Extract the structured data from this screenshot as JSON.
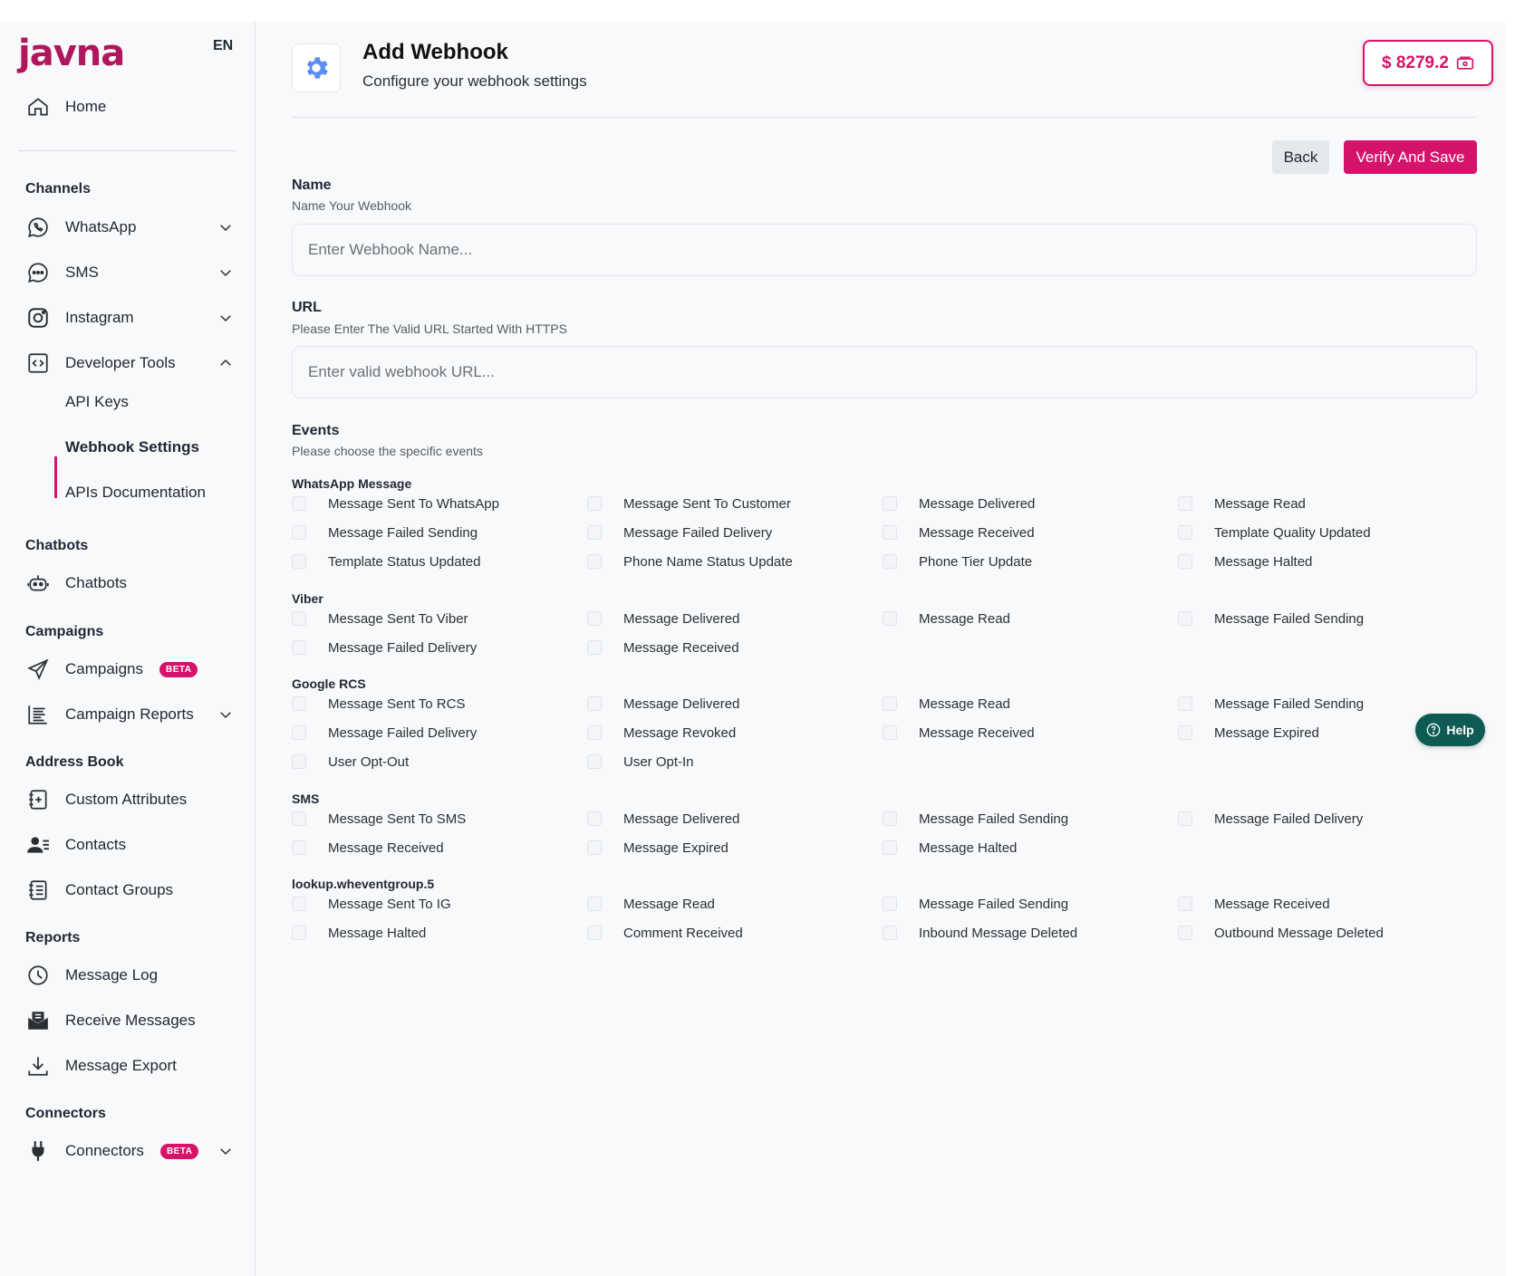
{
  "brand": {
    "logo_text": "javna",
    "language": "EN",
    "accent_color": "#d6136a",
    "help_color": "#0d5b52"
  },
  "sidebar": {
    "home": "Home",
    "sections": {
      "channels": "Channels",
      "chatbots": "Chatbots",
      "campaigns": "Campaigns",
      "address_book": "Address Book",
      "reports": "Reports",
      "connectors": "Connectors"
    },
    "channels": {
      "whatsapp": "WhatsApp",
      "sms": "SMS",
      "instagram": "Instagram",
      "developer_tools": "Developer Tools",
      "api_keys": "API Keys",
      "webhook_settings": "Webhook Settings",
      "apis_documentation": "APIs Documentation"
    },
    "chatbots_item": "Chatbots",
    "campaigns_item": "Campaigns",
    "campaigns_badge": "BETA",
    "campaign_reports": "Campaign Reports",
    "custom_attributes": "Custom Attributes",
    "contacts": "Contacts",
    "contact_groups": "Contact Groups",
    "message_log": "Message Log",
    "receive_messages": "Receive Messages",
    "message_export": "Message Export",
    "connectors_item": "Connectors",
    "connectors_badge": "BETA"
  },
  "header": {
    "title": "Add Webhook",
    "subtitle": "Configure your webhook settings",
    "balance": "$ 8279.2"
  },
  "actions": {
    "back": "Back",
    "save": "Verify And Save"
  },
  "form": {
    "name_label": "Name",
    "name_hint": "Name Your Webhook",
    "name_placeholder": "Enter Webhook Name...",
    "url_label": "URL",
    "url_hint": "Please Enter The Valid URL Started With HTTPS",
    "url_placeholder": "Enter valid webhook URL...",
    "events_label": "Events",
    "events_hint": "Please choose the specific events"
  },
  "event_groups": [
    {
      "title": "WhatsApp Message",
      "events": [
        "Message Sent To WhatsApp",
        "Message Sent To Customer",
        "Message Delivered",
        "Message Read",
        "Message Failed Sending",
        "Message Failed Delivery",
        "Message Received",
        "Template Quality Updated",
        "Template Status Updated",
        "Phone Name Status Update",
        "Phone Tier Update",
        "Message Halted"
      ]
    },
    {
      "title": "Viber",
      "events": [
        "Message Sent To Viber",
        "Message Delivered",
        "Message Read",
        "Message Failed Sending",
        "Message Failed Delivery",
        "Message Received"
      ]
    },
    {
      "title": "Google RCS",
      "events": [
        "Message Sent To RCS",
        "Message Delivered",
        "Message Read",
        "Message Failed Sending",
        "Message Failed Delivery",
        "Message Revoked",
        "Message Received",
        "Message Expired",
        "User Opt-Out",
        "User Opt-In"
      ]
    },
    {
      "title": "SMS",
      "events": [
        "Message Sent To SMS",
        "Message Delivered",
        "Message Failed Sending",
        "Message Failed Delivery",
        "Message Received",
        "Message Expired",
        "Message Halted"
      ]
    },
    {
      "title": "lookup.wheventgroup.5",
      "events": [
        "Message Sent To IG",
        "Message Read",
        "Message Failed Sending",
        "Message Received",
        "Message Halted",
        "Comment Received",
        "Inbound Message Deleted",
        "Outbound Message Deleted"
      ]
    }
  ],
  "help": {
    "label": "Help"
  }
}
